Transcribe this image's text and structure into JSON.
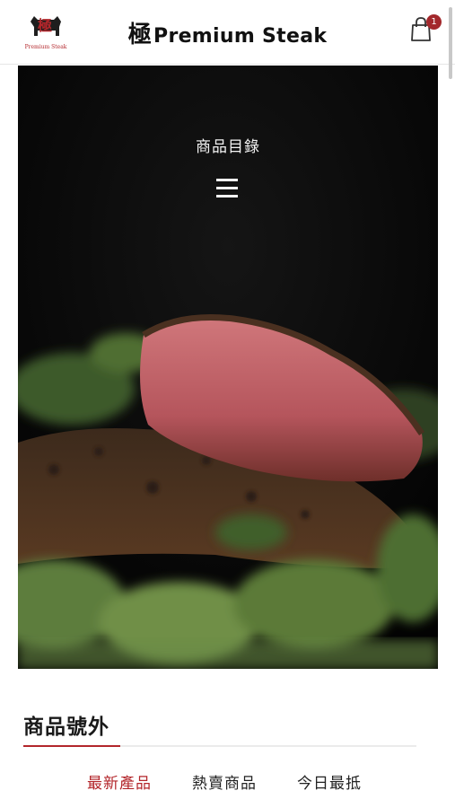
{
  "header": {
    "logo_text": "Premium Steak",
    "brand_kanji": "極",
    "brand_name": "Premium Steak",
    "cart_count": "1",
    "cart_icon": "shopping-bag-icon"
  },
  "hero": {
    "title": "商品目錄",
    "menu_icon": "hamburger-menu-icon"
  },
  "section": {
    "title": "商品號外",
    "tabs": [
      {
        "label": "最新產品",
        "active": true
      },
      {
        "label": "熱賣商品",
        "active": false
      },
      {
        "label": "今日最抵",
        "active": false
      }
    ]
  },
  "colors": {
    "accent": "#b3262b",
    "hero_background": "#050505"
  }
}
